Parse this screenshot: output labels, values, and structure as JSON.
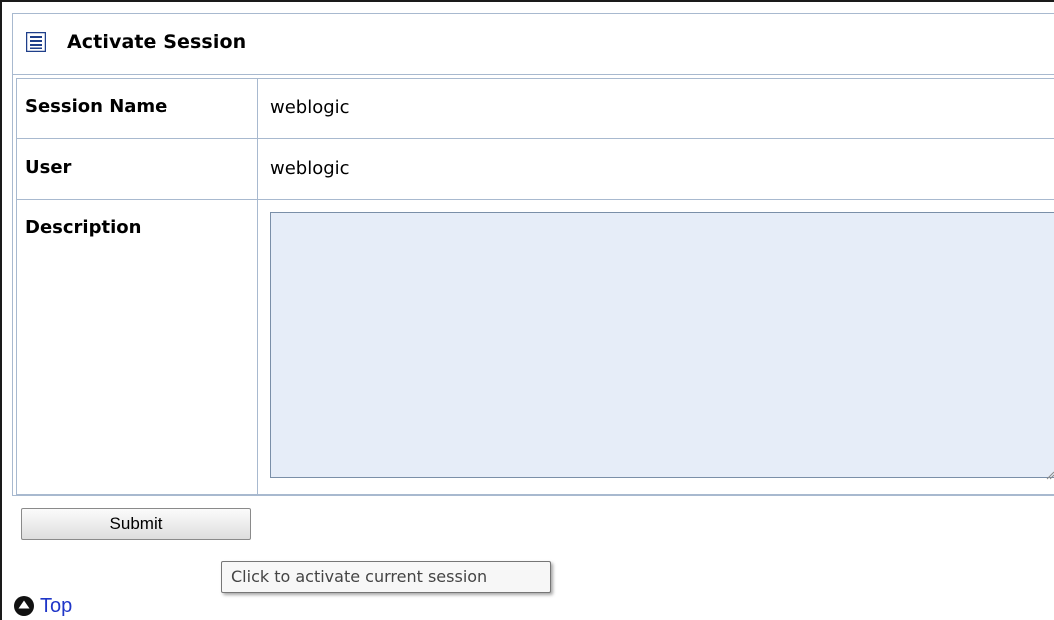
{
  "panel": {
    "title": "Activate Session",
    "icon": "list-icon"
  },
  "form": {
    "session_name_label": "Session Name",
    "session_name_value": "weblogic",
    "user_label": "User",
    "user_value": "weblogic",
    "description_label": "Description",
    "description_value": ""
  },
  "actions": {
    "submit_label": "Submit",
    "tooltip": "Click to activate current session"
  },
  "footer": {
    "top_label": "Top",
    "top_icon": "up-arrow-circle-icon"
  },
  "colors": {
    "border": "#a8b9cf",
    "textarea_bg": "#e6edf8",
    "link": "#1f36c8"
  }
}
